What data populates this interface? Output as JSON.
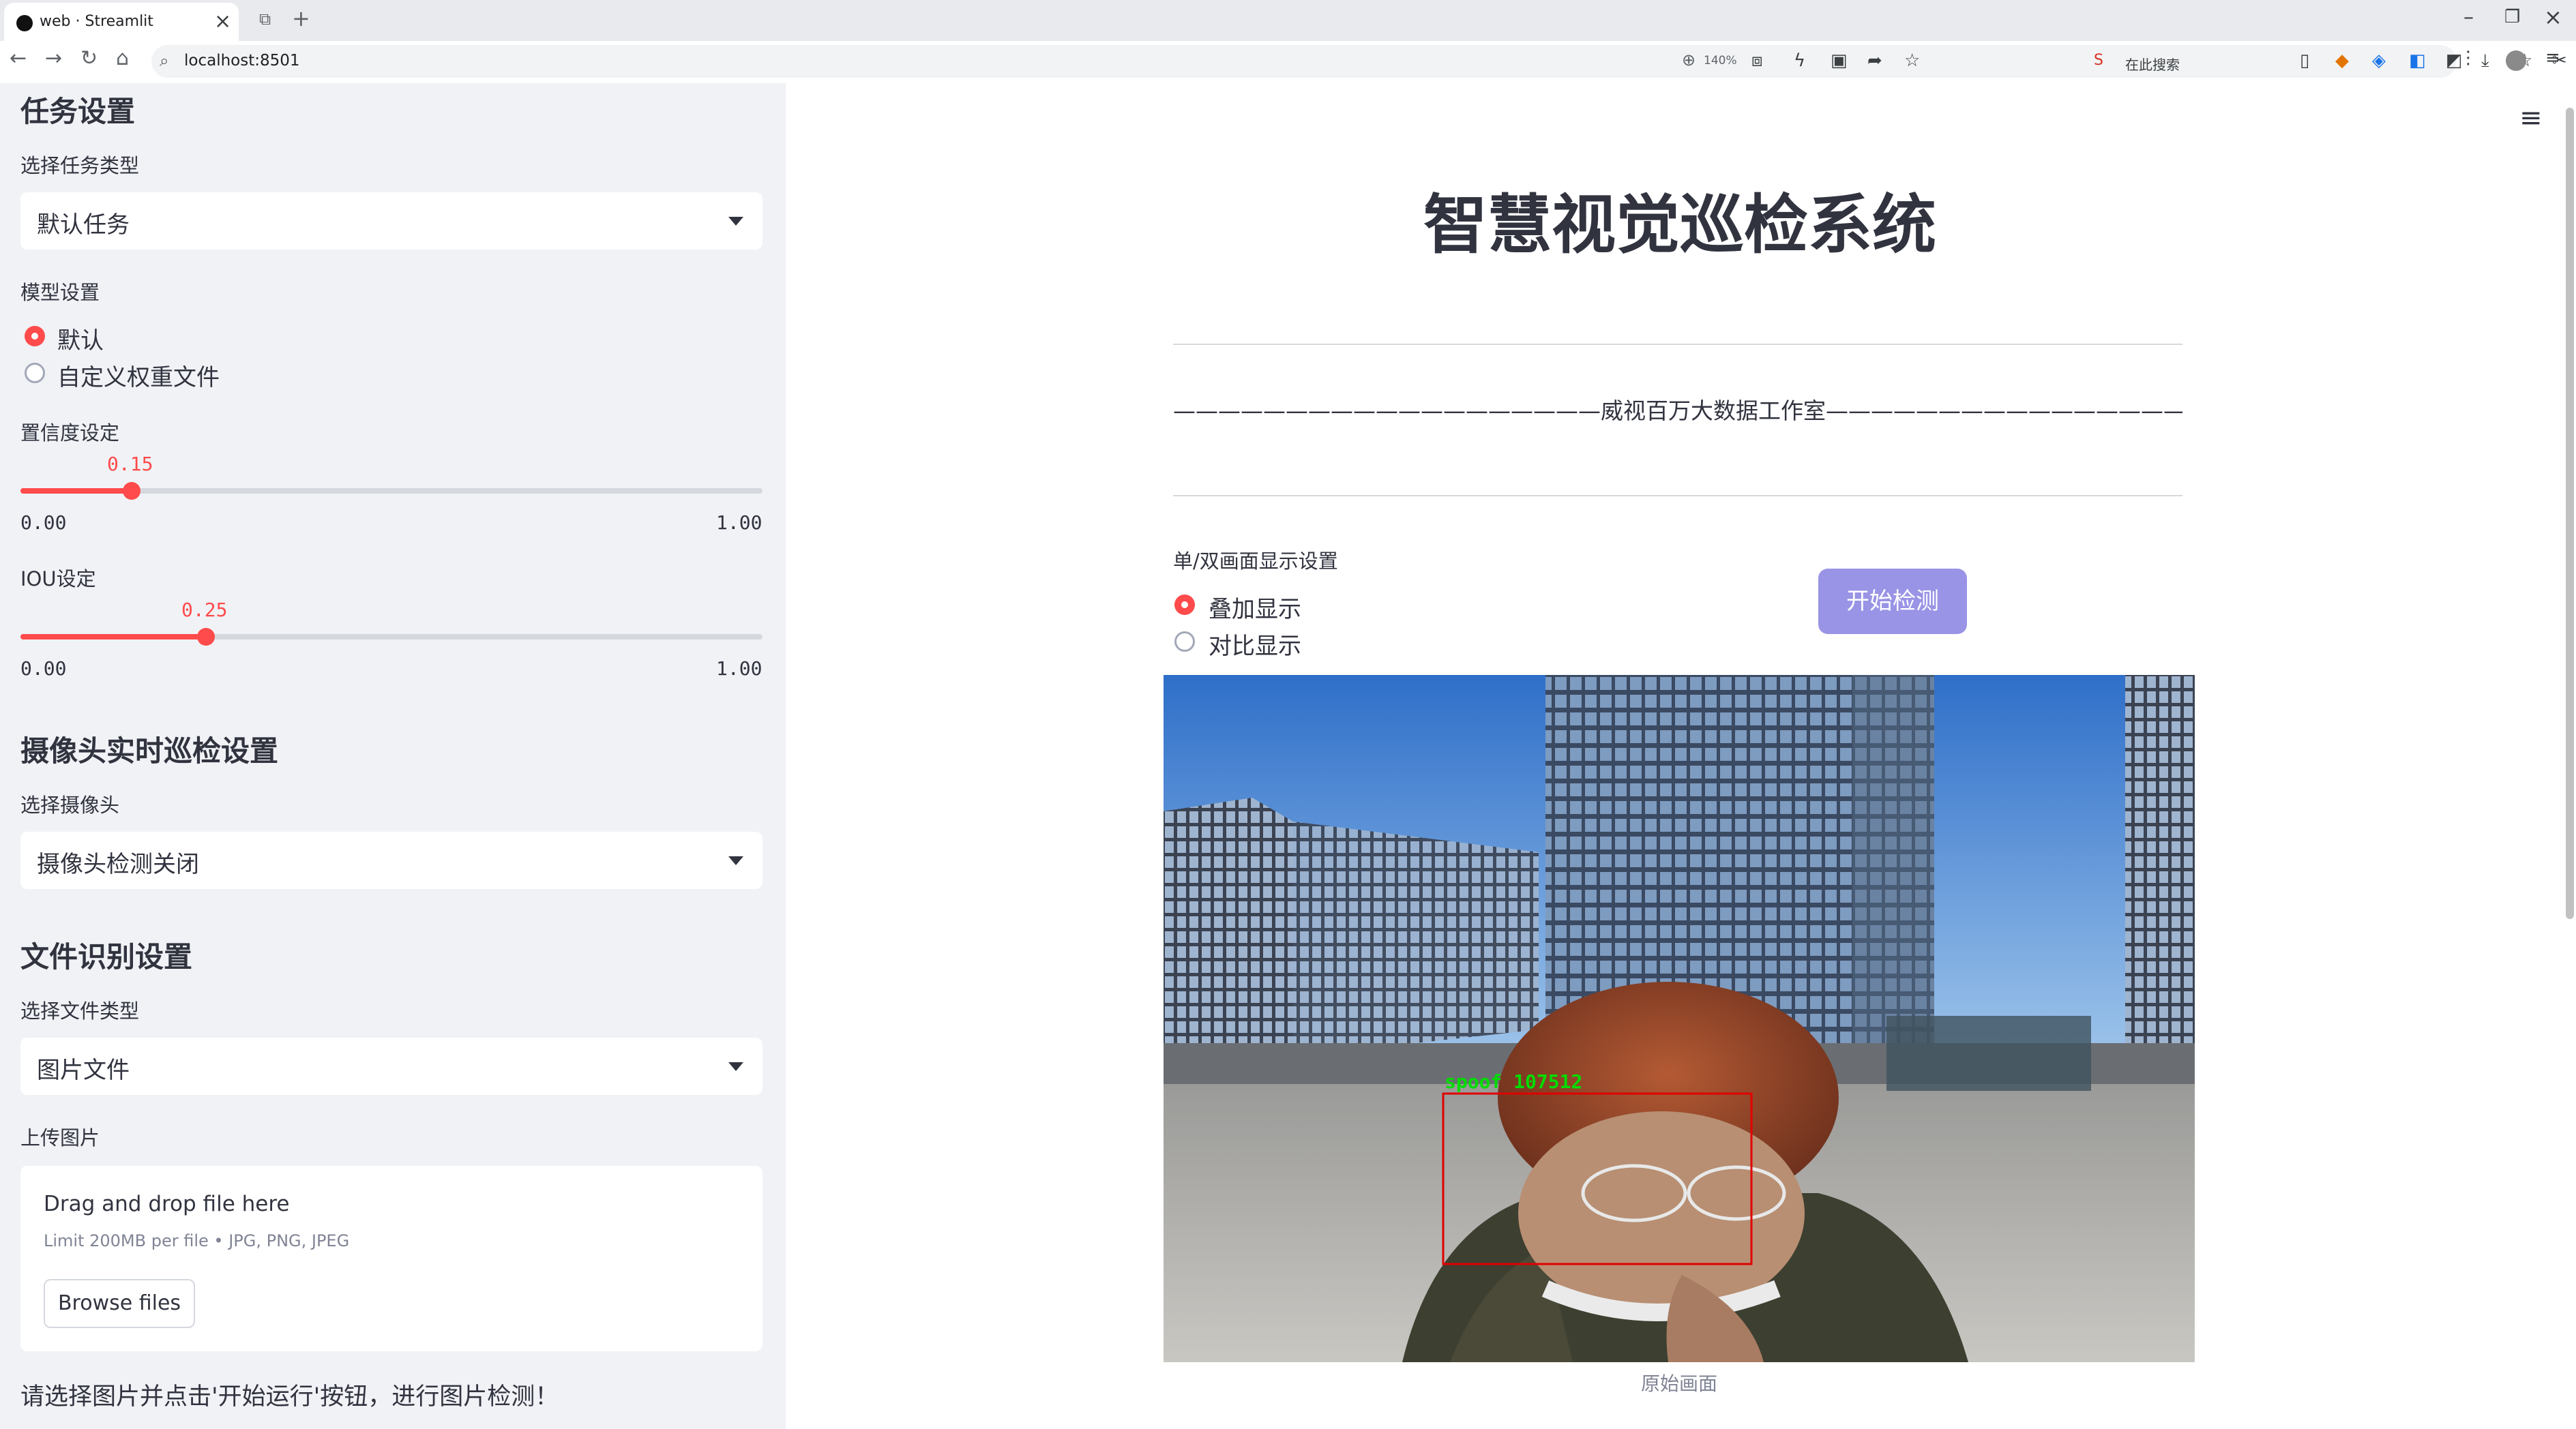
{
  "browser": {
    "tab_title": "web · Streamlit",
    "url": "localhost:8501",
    "zoom": "140%",
    "search_label": "在此搜索"
  },
  "sidebar": {
    "task_section": {
      "title": "任务设置",
      "select_label": "选择任务类型",
      "select_value": "默认任务"
    },
    "model_section": {
      "title": "模型设置",
      "options": [
        "默认",
        "自定义权重文件"
      ],
      "selected": "默认"
    },
    "confidence": {
      "label": "置信度设定",
      "value": 0.15,
      "value_text": "0.15",
      "min": "0.00",
      "max": "1.00"
    },
    "iou": {
      "label": "IOU设定",
      "value": 0.25,
      "value_text": "0.25",
      "min": "0.00",
      "max": "1.00"
    },
    "camera_section": {
      "title": "摄像头实时巡检设置",
      "select_label": "选择摄像头",
      "select_value": "摄像头检测关闭"
    },
    "file_section": {
      "title": "文件识别设置",
      "select_label": "选择文件类型",
      "select_value": "图片文件"
    },
    "upload": {
      "label": "上传图片",
      "drop_text": "Drag and drop file here",
      "limit_text": "Limit 200MB per file • JPG, PNG, JPEG",
      "browse_label": "Browse files"
    },
    "footer_text": "请选择图片并点击'开始运行'按钮，进行图片检测！"
  },
  "main": {
    "title": "智慧视觉巡检系统",
    "credit": "———————————————————威视百万大数据工作室————————————————————",
    "display_setting_label": "单/双画面显示设置",
    "display_options": [
      "叠加显示",
      "对比显示"
    ],
    "display_selected": "叠加显示",
    "start_button": "开始检测",
    "detection_label": "spoof  107512",
    "image_caption": "原始画面"
  },
  "colors": {
    "accent": "#ff4b4b",
    "button": "#9a94e6",
    "sidebar_bg": "#f0f2f6",
    "detection_box": "#e00000",
    "detection_text": "#00dd00"
  }
}
